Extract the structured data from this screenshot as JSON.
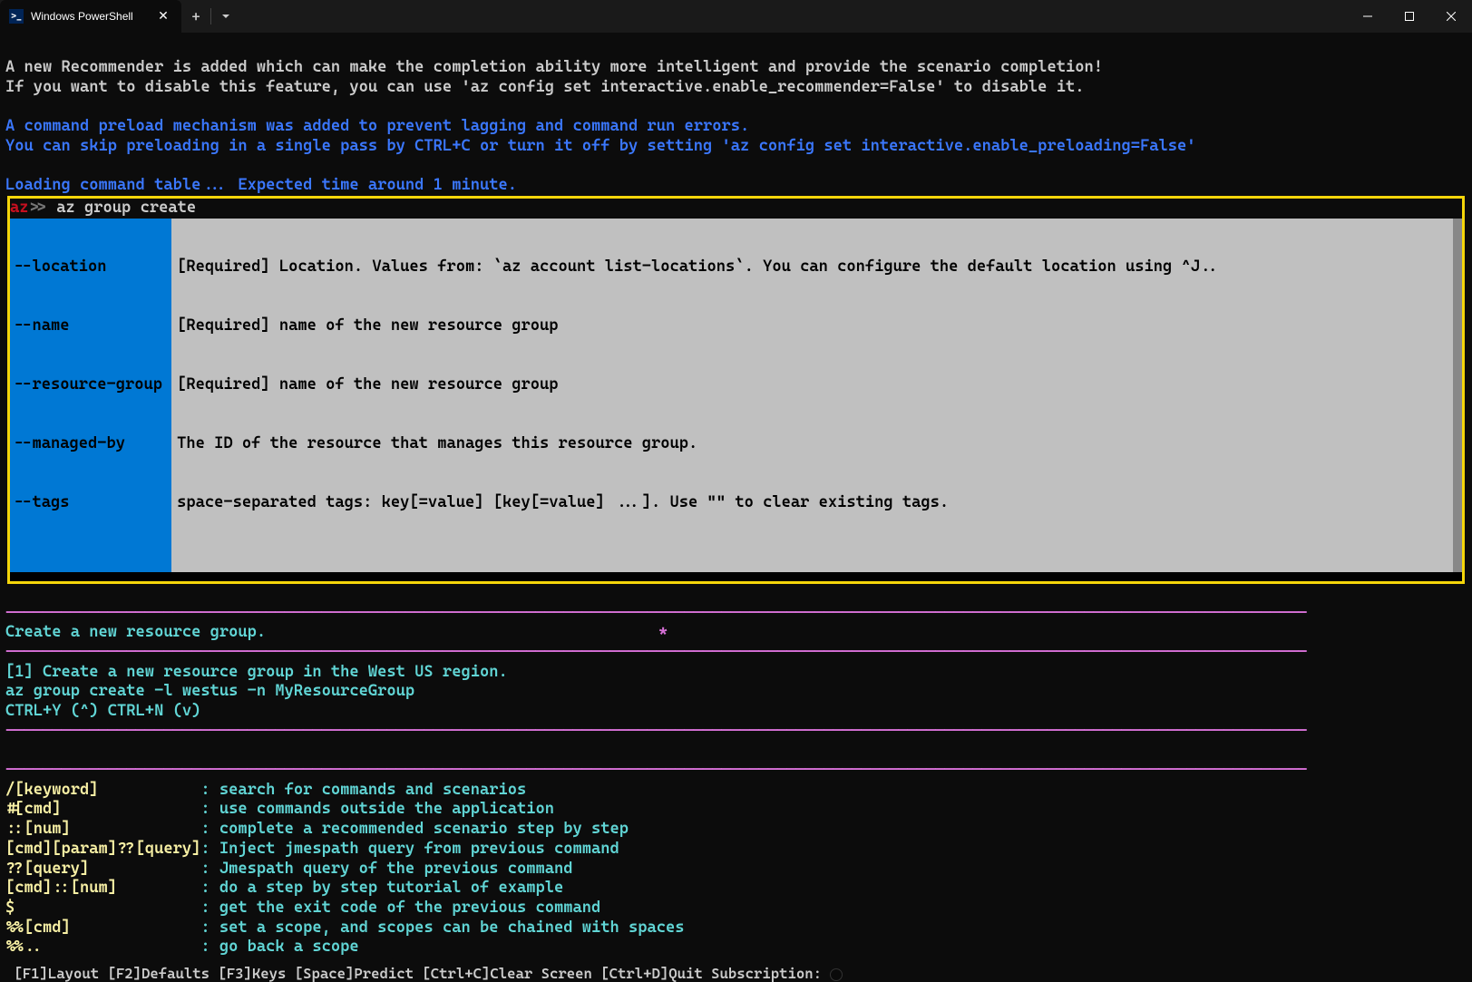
{
  "titlebar": {
    "tab_title": "Windows PowerShell",
    "icon_text": ">_"
  },
  "intro": {
    "line1": "A new Recommender is added which can make the completion ability more intelligent and provide the scenario completion!",
    "line2": "If you want to disable this feature, you can use 'az config set interactive.enable_recommender=False' to disable it."
  },
  "preload": {
    "line1": "A command preload mechanism was added to prevent lagging and command run errors.",
    "line2": "You can skip preloading in a single pass by CTRL+C or turn it off by setting 'az config set interactive.enable_preloading=False'"
  },
  "loading": "Loading command table... Expected time around 1 minute.",
  "prompt": {
    "az": "az",
    "gt": ">> ",
    "cmd": "az group create"
  },
  "autocomplete": {
    "params": [
      "--location",
      "--name",
      "--resource-group",
      "--managed-by",
      "--tags"
    ],
    "descs": [
      "[Required] Location. Values from: `az account list-locations`. You can configure the default location using ^J..",
      "[Required] name of the new resource group",
      "[Required] name of the new resource group",
      "The ID of the resource that manages this resource group.",
      "space-separated tags: key[=value] [key[=value] ...]. Use \"\" to clear existing tags."
    ]
  },
  "desc_title": "Create a new resource group.",
  "example": {
    "line1": "[1] Create a new resource group in the West US region.",
    "line2": "az group create -l westus -n MyResourceGroup",
    "line3": " CTRL+Y (^) CTRL+N (v)"
  },
  "help": [
    {
      "k": "/[keyword]           ",
      "d": ": search for commands and scenarios"
    },
    {
      "k": "#[cmd]               ",
      "d": ": use commands outside the application"
    },
    {
      "k": "::[num]              ",
      "d": ": complete a recommended scenario step by step"
    },
    {
      "k": "[cmd][param]??[query]",
      "d": ": Inject jmespath query from previous command"
    },
    {
      "k": "??[query]            ",
      "d": ": Jmespath query of the previous command"
    },
    {
      "k": "[cmd]::[num]         ",
      "d": ": do a step by step tutorial of example"
    },
    {
      "k": "$                    ",
      "d": ": get the exit code of the previous command"
    },
    {
      "k": "%%[cmd]              ",
      "d": ": set a scope, and scopes can be chained with spaces"
    },
    {
      "k": "%%..                 ",
      "d": ": go back a scope"
    }
  ],
  "bottombar": " [F1]Layout [F2]Defaults [F3]Keys [Space]Predict [Ctrl+C]Clear Screen [Ctrl+D]Quit Subscription: ",
  "separator": "--------------------------------------------------------------------------------------------------------------------------------------------",
  "asterisk": "*"
}
